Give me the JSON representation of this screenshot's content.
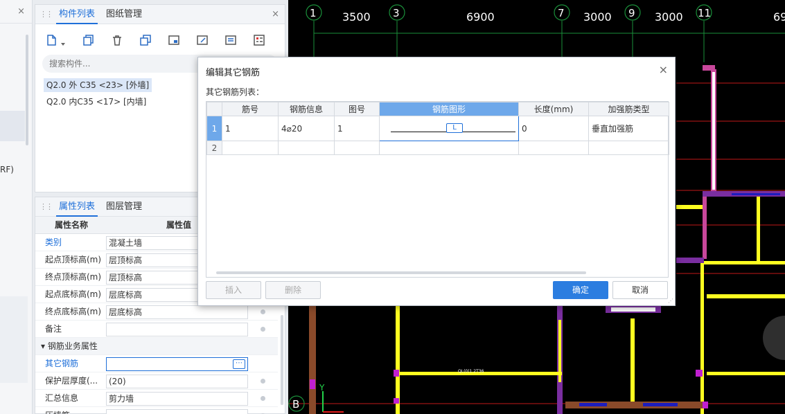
{
  "left_strip": {
    "close": "×",
    "rf_text": "RF)"
  },
  "component_panel": {
    "tabs": [
      {
        "label": "构件列表"
      },
      {
        "label": "图纸管理"
      }
    ],
    "close": "×",
    "search_placeholder": "搜索构件...",
    "items": [
      {
        "label": "Q2.0 外 C35 <23> [外墙]"
      },
      {
        "label": "Q2.0 内C35 <17> [内墙]"
      }
    ]
  },
  "property_panel": {
    "tabs": [
      {
        "label": "属性列表"
      },
      {
        "label": "图层管理"
      }
    ],
    "headers": {
      "name": "属性名称",
      "value": "属性值"
    },
    "rows": [
      {
        "name": "类别",
        "value": "混凝土墙"
      },
      {
        "name": "起点顶标高(m)",
        "value": "层顶标高"
      },
      {
        "name": "终点顶标高(m)",
        "value": "层顶标高"
      },
      {
        "name": "起点底标高(m)",
        "value": "层底标高"
      },
      {
        "name": "终点底标高(m)",
        "value": "层底标高"
      },
      {
        "name": "备注",
        "value": ""
      }
    ],
    "group": "钢筋业务属性",
    "group_rows": [
      {
        "name": "其它钢筋",
        "value": "",
        "more": "⋯"
      },
      {
        "name": "保护层厚度(...",
        "value": "(20)"
      },
      {
        "name": "汇总信息",
        "value": "剪力墙"
      },
      {
        "name": "压墙筋",
        "value": ""
      }
    ]
  },
  "cad": {
    "axis_labels": [
      "1",
      "3",
      "7",
      "9",
      "11",
      "B"
    ],
    "dimensions": [
      "3500",
      "6900",
      "3000",
      "3000",
      "69"
    ],
    "axis_y": "Y",
    "tiny_text": "QL(0)1.2T36"
  },
  "dialog": {
    "title": "编辑其它钢筋",
    "close": "×",
    "subtitle": "其它钢筋列表：",
    "columns": [
      "筋号",
      "钢筋信息",
      "图号",
      "钢筋图形",
      "长度(mm)",
      "加强筋类型"
    ],
    "rows": [
      {
        "num": "1",
        "bar_no": "1",
        "info": "4⌀20",
        "fig_no": "1",
        "shape_btn": "L",
        "length": "0",
        "type": "垂直加强筋"
      },
      {
        "num": "2",
        "bar_no": "",
        "info": "",
        "fig_no": "",
        "shape_btn": "",
        "length": "",
        "type": ""
      }
    ],
    "buttons": {
      "insert": "插入",
      "delete": "删除",
      "ok": "确定",
      "cancel": "取消"
    }
  }
}
